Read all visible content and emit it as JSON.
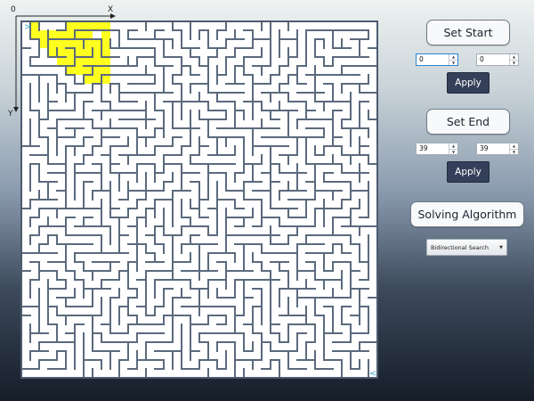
{
  "axes": {
    "origin_label": "0",
    "x_label": "X",
    "y_label": "Y"
  },
  "maze": {
    "cols": 40,
    "rows": 40,
    "start": [
      0,
      0
    ],
    "end": [
      39,
      39
    ],
    "start_marker": ">",
    "end_marker": "<",
    "wall_color": "#5b6a7d",
    "border_color": "#4d5b6f",
    "path_color": "#ffff1f",
    "marker_color": "#3aa7c9",
    "highlight_cells": [
      [
        1,
        0
      ],
      [
        1,
        1
      ],
      [
        2,
        1
      ],
      [
        3,
        1
      ],
      [
        4,
        1
      ],
      [
        5,
        1
      ],
      [
        5,
        2
      ],
      [
        6,
        2
      ],
      [
        6,
        3
      ],
      [
        7,
        3
      ],
      [
        7,
        4
      ],
      [
        8,
        4
      ],
      [
        8,
        5
      ],
      [
        9,
        5
      ],
      [
        4,
        2
      ],
      [
        4,
        3
      ],
      [
        5,
        3
      ],
      [
        6,
        4
      ],
      [
        6,
        5
      ],
      [
        7,
        5
      ],
      [
        7,
        6
      ],
      [
        8,
        6
      ],
      [
        9,
        6
      ],
      [
        5,
        0
      ],
      [
        6,
        0
      ],
      [
        7,
        0
      ],
      [
        8,
        0
      ],
      [
        9,
        0
      ],
      [
        9,
        1
      ],
      [
        9,
        2
      ],
      [
        9,
        3
      ],
      [
        8,
        3
      ],
      [
        8,
        2
      ],
      [
        7,
        2
      ],
      [
        6,
        1
      ],
      [
        7,
        1
      ],
      [
        2,
        2
      ],
      [
        3,
        2
      ],
      [
        3,
        3
      ],
      [
        4,
        4
      ],
      [
        5,
        4
      ],
      [
        5,
        5
      ],
      [
        9,
        4
      ]
    ]
  },
  "set_start": {
    "title": "Set Start",
    "x_value": "0",
    "y_value": "0",
    "apply_label": "Apply"
  },
  "set_end": {
    "title": "Set End",
    "x_value": "39",
    "y_value": "39",
    "apply_label": "Apply"
  },
  "algorithm": {
    "title": "Solving Algorithm",
    "selected": "Bidirectional Search"
  }
}
